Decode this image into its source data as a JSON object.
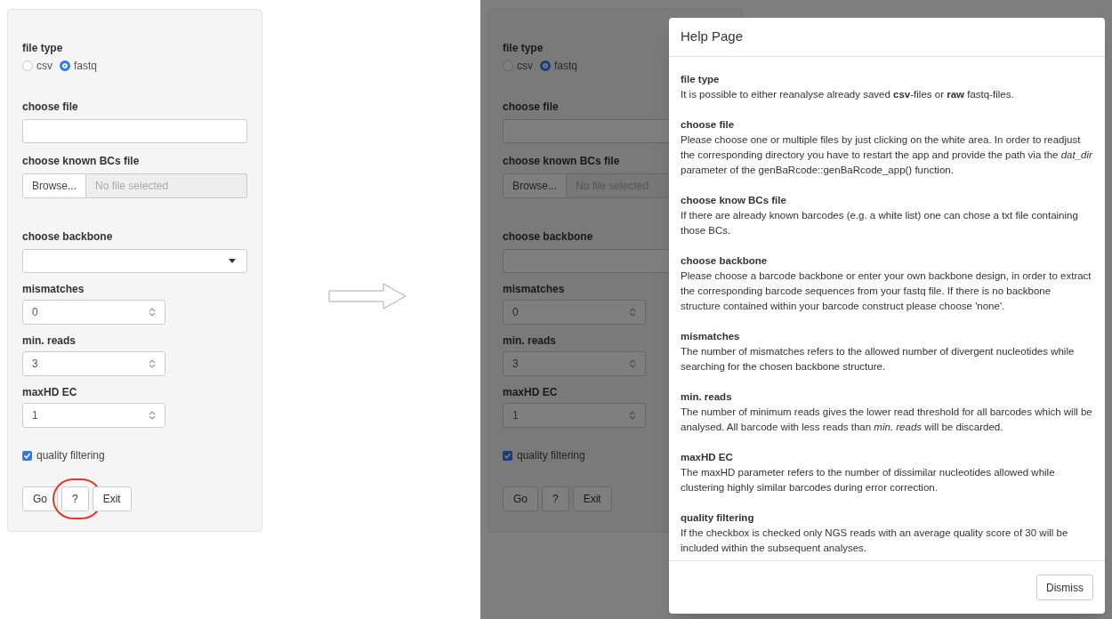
{
  "before_panel": {
    "file_type": {
      "label": "file type",
      "options": [
        {
          "label": "csv",
          "selected": false
        },
        {
          "label": "fastq",
          "selected": true
        }
      ]
    },
    "choose_file": {
      "label": "choose file"
    },
    "known_bcs": {
      "label": "choose known BCs file",
      "browse_button": "Browse...",
      "file_name": "No file selected"
    },
    "backbone": {
      "label": "choose backbone"
    },
    "numeric_inputs": [
      {
        "label": "mismatches",
        "value": "0"
      },
      {
        "label": "min. reads",
        "value": "3"
      },
      {
        "label": "maxHD EC",
        "value": "1"
      }
    ],
    "quality_filtering": {
      "label": "quality filtering",
      "checked": true
    },
    "buttons": [
      {
        "label": "Go",
        "highlighted": false
      },
      {
        "label": "?",
        "highlighted": true
      },
      {
        "label": "Exit",
        "highlighted": false
      }
    ]
  },
  "after_panel": {
    "file_type": {
      "label": "file type",
      "options": [
        {
          "label": "csv",
          "selected": false
        },
        {
          "label": "fastq",
          "selected": true
        }
      ]
    },
    "choose_file": {
      "label": "choose file"
    },
    "known_bcs": {
      "label": "choose known BCs file",
      "browse_button": "Browse...",
      "file_name": "No file selected"
    },
    "backbone": {
      "label": "choose backbone"
    },
    "numeric_inputs": [
      {
        "label": "mismatches",
        "value": "0"
      },
      {
        "label": "min. reads",
        "value": "3"
      },
      {
        "label": "maxHD EC",
        "value": "1"
      }
    ],
    "quality_filtering": {
      "label": "quality filtering",
      "checked": true
    },
    "buttons": [
      {
        "label": "Go",
        "highlighted": false
      },
      {
        "label": "?",
        "highlighted": false
      },
      {
        "label": "Exit",
        "highlighted": false
      }
    ]
  },
  "help_modal": {
    "title": "Help Page",
    "sections": [
      {
        "heading": "file type",
        "text": "It is possible to either reanalyse already saved **csv**-files or **raw** fastq-files."
      },
      {
        "heading": "choose file",
        "text": "Please choose one or multiple files by just clicking on the white area. In order to readjust the corresponding directory you have to restart the app and provide the path via the *dat_dir* parameter of the genBaRcode::genBaRcode_app() function."
      },
      {
        "heading": "choose know BCs file",
        "text": "If there are already known barcodes (e.g. a white list) one can chose a txt file containing those BCs."
      },
      {
        "heading": "choose backbone",
        "text": "Please choose a barcode backbone or enter your own backbone design, in order to extract the corresponding barcode sequences from your fastq file. If there is no backbone structure contained within your barcode construct please choose 'none'."
      },
      {
        "heading": "mismatches",
        "text": "The number of mismatches refers to the allowed number of divergent nucleotides while searching for the chosen backbone structure."
      },
      {
        "heading": "min. reads",
        "text": "The number of minimum reads gives the lower read threshold for all barcodes which will be analysed. All barcode with less reads than *min. reads* will be discarded."
      },
      {
        "heading": "maxHD EC",
        "text": "The maxHD parameter refers to the number of dissimilar nucleotides allowed while clustering highly similar barcodes during error correction."
      },
      {
        "heading": "quality filtering",
        "text": "If the checkbox is checked only NGS reads with an average quality score of 30 will be included within the subsequent analyses."
      }
    ],
    "dismiss_button": "Dismiss"
  }
}
